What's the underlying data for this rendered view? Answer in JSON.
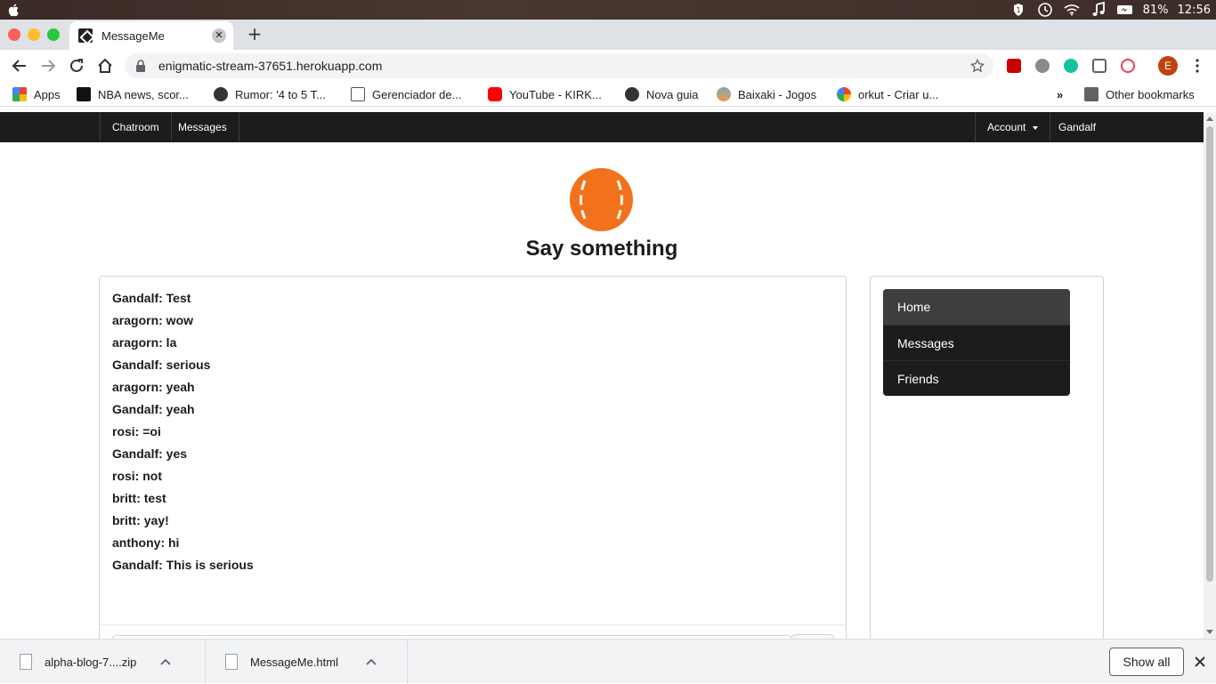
{
  "menubar": {
    "battery": "81%",
    "time": "12:56"
  },
  "browser": {
    "tab_title": "MessageMe",
    "tab_close": "✕",
    "new_tab": "+",
    "url": "enigmatic-stream-37651.herokuapp.com",
    "profile_initial": "E"
  },
  "bookmarks": {
    "items": [
      {
        "label": "Apps",
        "icon": "apps-grid-icon"
      },
      {
        "label": "NBA news, scor...",
        "icon": "br-icon"
      },
      {
        "label": "Rumor: '4 to 5 T...",
        "icon": "globe-icon"
      },
      {
        "label": "Gerenciador de...",
        "icon": "doc-icon"
      },
      {
        "label": "YouTube - KIRK...",
        "icon": "youtube-icon"
      },
      {
        "label": "Nova guia",
        "icon": "globe-icon"
      },
      {
        "label": "Baixaki - Jogos",
        "icon": "baixaki-icon"
      },
      {
        "label": "orkut - Criar u...",
        "icon": "google-icon"
      }
    ],
    "more": "»",
    "other": "Other bookmarks"
  },
  "app": {
    "nav": {
      "chatroom": "Chatroom",
      "messages": "Messages",
      "account": "Account",
      "user": "Gandalf"
    },
    "heading": "Say something",
    "messages": [
      "Gandalf: Test",
      "aragorn: wow",
      "aragorn: la",
      "Gandalf: serious",
      "aragorn: yeah",
      "Gandalf: yeah",
      "rosi: =oi",
      "Gandalf: yes",
      "rosi: not",
      "britt: test",
      "britt: yay!",
      "anthony: hi",
      "Gandalf: This is serious"
    ],
    "sidemenu": [
      "Home",
      "Messages",
      "Friends"
    ],
    "sidemenu_active": "Home",
    "logo_color": "#f2711c"
  },
  "downloads": {
    "items": [
      "alpha-blog-7....zip",
      "MessageMe.html"
    ],
    "show_all": "Show all"
  }
}
